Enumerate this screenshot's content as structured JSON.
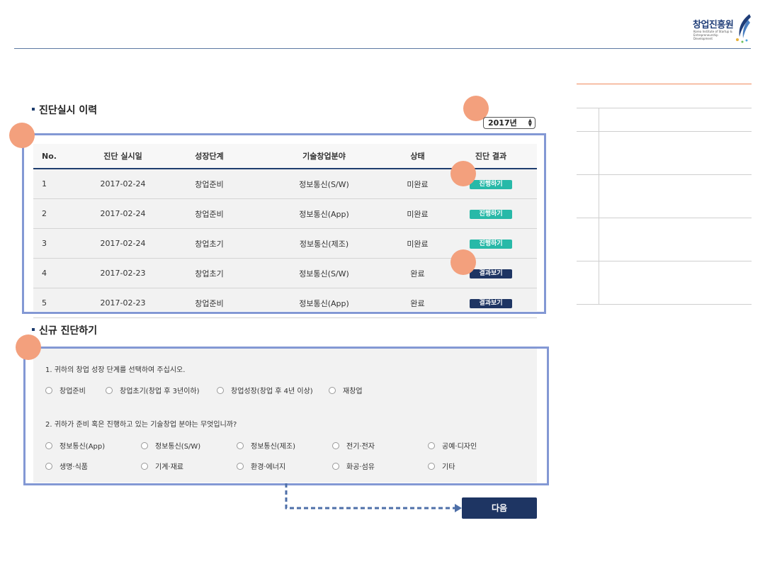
{
  "logo": {
    "name": "창업진흥원",
    "subtitle": "Korea Institute of Startup & Entrepreneurship Development"
  },
  "history": {
    "title": "진단실시 이력",
    "year_select": "2017년",
    "columns": [
      "No.",
      "진단 실시일",
      "성장단계",
      "기술창업분야",
      "상태",
      "진단 결과"
    ],
    "rows": [
      {
        "no": "1",
        "date": "2017-02-24",
        "stage": "창업준비",
        "field": "정보통신(S/W)",
        "status": "미완료",
        "action": "진행하기",
        "action_type": "go"
      },
      {
        "no": "2",
        "date": "2017-02-24",
        "stage": "창업준비",
        "field": "정보통신(App)",
        "status": "미완료",
        "action": "진행하기",
        "action_type": "go"
      },
      {
        "no": "3",
        "date": "2017-02-24",
        "stage": "창업초기",
        "field": "정보통신(제조)",
        "status": "미완료",
        "action": "진행하기",
        "action_type": "go"
      },
      {
        "no": "4",
        "date": "2017-02-23",
        "stage": "창업초기",
        "field": "정보통신(S/W)",
        "status": "완료",
        "action": "결과보기",
        "action_type": "result"
      },
      {
        "no": "5",
        "date": "2017-02-23",
        "stage": "창업준비",
        "field": "정보통신(App)",
        "status": "완료",
        "action": "결과보기",
        "action_type": "result"
      }
    ]
  },
  "new_diagnosis": {
    "title": "신규 진단하기",
    "q1": "1. 귀하의 창업 성장 단계를 선택하여 주십시오.",
    "q1_options": [
      "창업준비",
      "창업초기(창업 후 3년이하)",
      "창업성장(창업 후 4년 이상)",
      "재창업"
    ],
    "q2": "2. 귀하가 준비 혹은 진행하고 있는 기술창업 분야는 무엇입니까?",
    "q2_options_row1": [
      "정보통신(App)",
      "정보통신(S/W)",
      "정보통신(제조)",
      "전기·전자",
      "공예·디자인"
    ],
    "q2_options_row2": [
      "생명·식품",
      "기계·재료",
      "환경·에너지",
      "화공·섬유",
      "기타"
    ]
  },
  "next_button": "다음",
  "colors": {
    "navy": "#1e3563",
    "teal": "#28b9a8",
    "marker": "#f3a07d",
    "highlight_border": "#8398d4",
    "side_accent": "#f08a5d"
  }
}
